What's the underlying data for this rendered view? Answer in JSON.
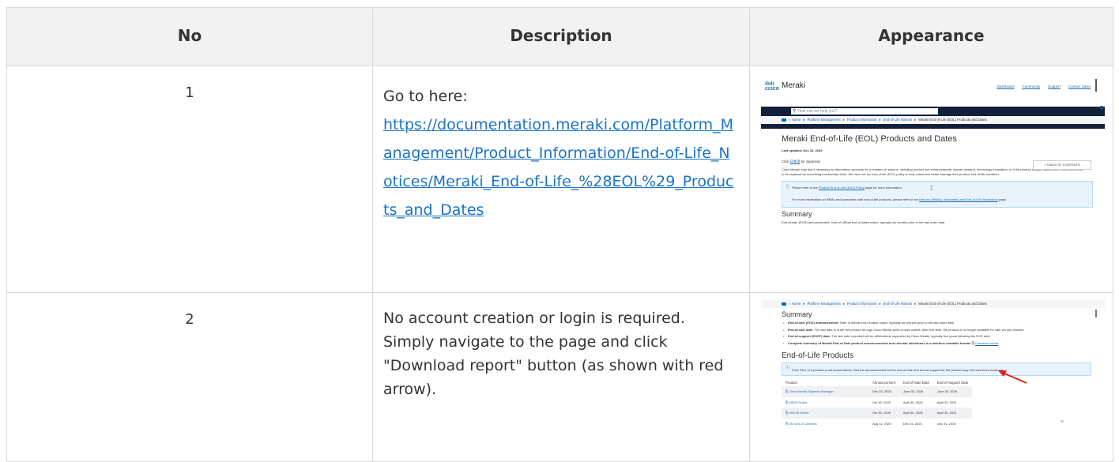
{
  "table": {
    "headers": {
      "no": "No",
      "description": "Description",
      "appearance": "Appearance"
    },
    "rows": [
      {
        "no": "1",
        "desc_intro": "Go to here:",
        "desc_link": "https://documentation.meraki.com/Platform_Management/Product_Information/End-of-Life_Notices/Meraki_End-of-Life_%28EOL%29_Products_and_Dates"
      },
      {
        "no": "2",
        "desc_text": "No account creation or login is required. Simply navigate to the page and click \"Download report\" button (as shown with red arrow)."
      }
    ]
  },
  "shot1": {
    "brand": "Meraki",
    "top_links": [
      "Dashboard",
      "Community",
      "Support",
      "Contact Sales"
    ],
    "search_placeholder": "How can we help you?",
    "breadcrumbs": [
      "Home",
      "Platform Management",
      "Product Information",
      "End-of-Life Notices",
      "Meraki End-of-Life (EOL) Products and Dates"
    ],
    "page_title": "Meraki End-of-Life (EOL) Products and Dates",
    "last_updated": "Last updated: Dec 15, 2025",
    "click_prefix": "Click ",
    "click_link": "日本語",
    "click_suffix": " for Japanese",
    "toc_button": "+ TABLE OF CONTENTS",
    "paragraph": "Cisco Meraki may find it necessary to discontinue products for a number of reasons, including product line enhancements, market demand, technology innovation, or if the product simply matures over time and needs to be replaced by something functionally richer. We have set our end-of-life (EOL) policy to help customers better manage their product end-of-life transition.",
    "info_line1_prefix": "Please refer to the ",
    "info_line1_link": "Product End-of-Life (EOL) Policy",
    "info_line1_suffix": " page for more information.",
    "info_line2_prefix": "For more information on RMAs and warranties with end-of-life products, please refer to the ",
    "info_line2_link": "Returns (RMAs), Warranties and End-of-Life Information",
    "info_line2_suffix": " page.",
    "summary_heading": "Summary",
    "summary_cut": "End-of-sale (EOS) announcement: Date of official end-of-sales notice, typically six months prior to the last order date."
  },
  "shot2": {
    "breadcrumbs": [
      "Home",
      "Platform Management",
      "Product Information",
      "End-of-Life Notices",
      "Meraki End-of-Life (EOL) Products and Dates"
    ],
    "summary_heading": "Summary",
    "bullets": [
      {
        "bold": "End-of-sale (EOS) announcement:",
        "text": " Date of official end-of-sales notice, typically six months prior to the last order date."
      },
      {
        "bold": "End-of-sale date:",
        "text": " The last date to order the product through Cisco Meraki point-of-sale outlets. After this date, the product is no longer available for sale via any channel."
      },
      {
        "bold": "End-of-support (EOST) date:",
        "text": " The last date a product will be affirmatively supported by Cisco Meraki, typically five years following the EOS date."
      },
      {
        "bold": "Complete summary of Meraki End-of-Sale product announcements and relevant milestones in a machine-readable format:",
        "text": "",
        "link": "Download report"
      }
    ],
    "eol_heading": "End-of-Life Products",
    "info_text": "If the SKU of a product is not shown below, then the announcement for the end-of-sale and end-of-support for the product may not have been made yet.",
    "product_table": {
      "columns": [
        "Product",
        "Announcement",
        "End-of-Sale Date",
        "End-of-Support Date"
      ],
      "rows": [
        [
          "Cisco Meraki Systems Manager",
          "Dec 03, 2025",
          "June 03, 2026",
          "June 03, 2029"
        ],
        [
          "MR29 Series",
          "Oct 30, 2025",
          "April 30, 2026",
          "April 30, 2031"
        ],
        [
          "MS225 Series",
          "Oct 30, 2025",
          "April 30, 2026",
          "April 30, 2031"
        ],
        [
          "MV Gen 2 Cameras",
          "Aug 11, 2025",
          "Dec 31, 2025",
          "Dec 31, 2030"
        ]
      ]
    },
    "arrow_color": "#e0201b"
  }
}
